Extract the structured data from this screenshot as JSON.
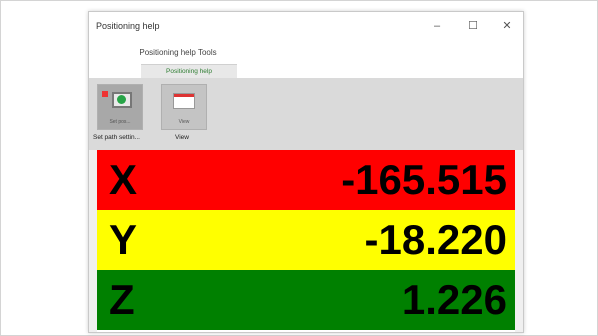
{
  "window": {
    "title": "Positioning help",
    "minimize_glyph": "–",
    "maximize_glyph": "☐",
    "close_glyph": "✕"
  },
  "ribbon": {
    "context_group": "Positioning help Tools",
    "active_tab": "Positioning help",
    "buttons": [
      {
        "label": "Set pos...",
        "icon": "monitor-icon"
      },
      {
        "label": "View",
        "icon": "window-icon"
      }
    ],
    "groups": [
      "Set path settin...",
      "View"
    ]
  },
  "axes": [
    {
      "axis": "X",
      "value": "-165.515",
      "color": "#ff0000"
    },
    {
      "axis": "Y",
      "value": "-18.220",
      "color": "#ffff00"
    },
    {
      "axis": "Z",
      "value": "1.226",
      "color": "#008000"
    }
  ]
}
